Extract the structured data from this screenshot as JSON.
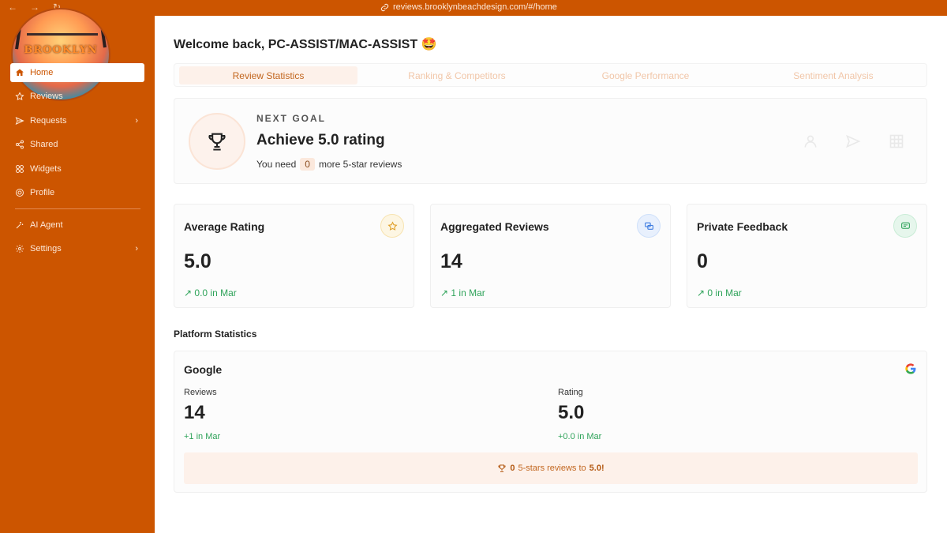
{
  "browser": {
    "back_glyph": "←",
    "forward_glyph": "→",
    "reload_glyph": "↻",
    "url": "reviews.brooklynbeachdesign.com/#/home"
  },
  "sidebar": {
    "logo_text": "BROOKLYN",
    "items": [
      {
        "label": "Home",
        "icon": "home-icon"
      },
      {
        "label": "Reviews",
        "icon": "star-icon"
      },
      {
        "label": "Requests",
        "icon": "send-icon"
      },
      {
        "label": "Shared",
        "icon": "share-icon"
      },
      {
        "label": "Widgets",
        "icon": "widgets-icon"
      },
      {
        "label": "Profile",
        "icon": "profile-icon"
      },
      {
        "label": "AI Agent",
        "icon": "ai-agent-icon"
      },
      {
        "label": "Settings",
        "icon": "settings-icon"
      }
    ],
    "chevron": "›"
  },
  "header": {
    "welcome": "Welcome back, PC-ASSIST/MAC-ASSIST 🤩"
  },
  "tabs": [
    {
      "label": "Review Statistics",
      "active": true
    },
    {
      "label": "Ranking & Competitors",
      "active": false
    },
    {
      "label": "Google Performance",
      "active": false
    },
    {
      "label": "Sentiment Analysis",
      "active": false
    }
  ],
  "goal": {
    "label": "NEXT GOAL",
    "title": "Achieve 5.0 rating",
    "need_prefix": "You need",
    "need_value": "0",
    "need_suffix": "more 5-star reviews"
  },
  "cards": [
    {
      "title": "Average Rating",
      "value": "5.0",
      "trend": "↗  0.0 in Mar",
      "icon": "star-icon",
      "icon_color": "#e0a02a",
      "icon_bg": "#fdf6e3"
    },
    {
      "title": "Aggregated Reviews",
      "value": "14",
      "trend": "↗  1 in Mar",
      "icon": "chat-icon",
      "icon_color": "#3d7be0",
      "icon_bg": "#e8f0fd"
    },
    {
      "title": "Private Feedback",
      "value": "0",
      "trend": "↗  0 in Mar",
      "icon": "message-icon",
      "icon_color": "#2fa35a",
      "icon_bg": "#e6f6ec"
    }
  ],
  "platform": {
    "section_title": "Platform Statistics",
    "name": "Google",
    "reviews_label": "Reviews",
    "reviews_value": "14",
    "reviews_trend": "+1 in Mar",
    "rating_label": "Rating",
    "rating_value": "5.0",
    "rating_trend": "+0.0 in Mar",
    "banner_count": "0",
    "banner_text": "5-stars reviews to",
    "banner_target": "5.0!"
  },
  "colors": {
    "brand": "#cc5500",
    "trend_green": "#2fa35a"
  }
}
